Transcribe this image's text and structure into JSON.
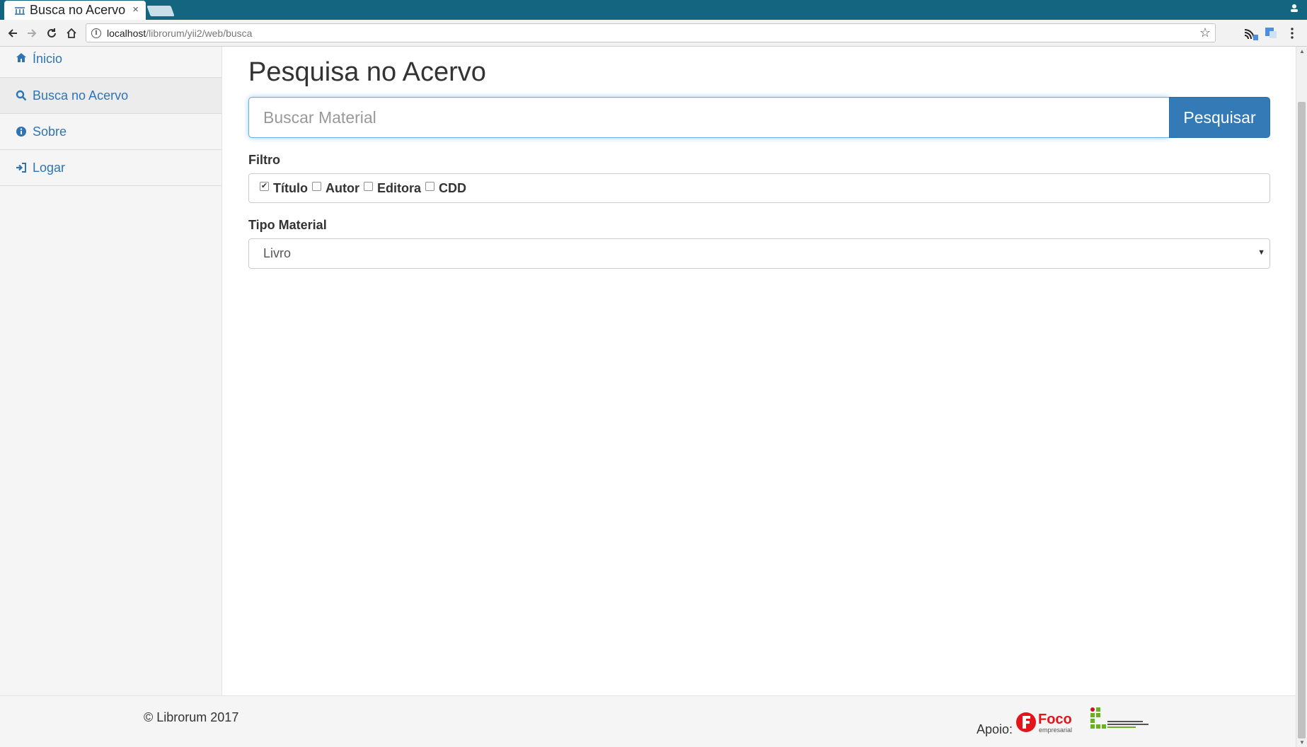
{
  "browser": {
    "tab_title": "Busca no Acervo",
    "tab_close": "×",
    "url_host": "localhost",
    "url_path": "/librorum/yii2/web/busca"
  },
  "sidebar": {
    "items": [
      {
        "label": "Ínicio",
        "icon": "home-icon"
      },
      {
        "label": "Busca no Acervo",
        "icon": "search-icon"
      },
      {
        "label": "Sobre",
        "icon": "info-icon"
      },
      {
        "label": "Logar",
        "icon": "login-icon"
      }
    ],
    "active_index": 1
  },
  "main": {
    "title": "Pesquisa no Acervo",
    "search": {
      "placeholder": "Buscar Material",
      "value": "",
      "button_label": "Pesquisar"
    },
    "filter": {
      "label": "Filtro",
      "options": [
        {
          "label": "Título",
          "checked": true
        },
        {
          "label": "Autor",
          "checked": false
        },
        {
          "label": "Editora",
          "checked": false
        },
        {
          "label": "CDD",
          "checked": false
        }
      ]
    },
    "tipo_material": {
      "label": "Tipo Material",
      "selected": "Livro",
      "arrow": "▼"
    }
  },
  "footer": {
    "copyright": "© Librorum 2017",
    "apoio_label": "Apoio:",
    "sponsor_foco": "Foco",
    "sponsor_foco_sub": "empresarial"
  },
  "colors": {
    "tabbar": "#146580",
    "link": "#2f74b5",
    "primary_button": "#337ab7"
  }
}
